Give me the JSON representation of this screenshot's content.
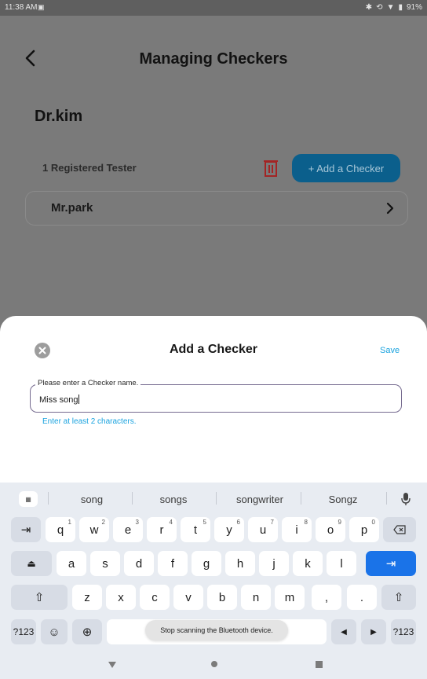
{
  "status_bar": {
    "time": "11:38 AM",
    "notif_icon": "ꟷ",
    "battery": "91%"
  },
  "app": {
    "title": "Managing Checkers",
    "owner_name": "Dr.kim",
    "registered_count": "1 Registered Tester",
    "add_checker_label": "+ Add a Checker",
    "checkers": [
      {
        "name": "Mr.park"
      }
    ]
  },
  "sheet": {
    "title": "Add a Checker",
    "save_label": "Save",
    "field_label": "Please enter a Checker name.",
    "field_value": "Miss song",
    "helper_text": "Enter at least 2 characters."
  },
  "keyboard": {
    "suggestions": [
      "song",
      "songs",
      "songwriter",
      "Songz"
    ],
    "row1": [
      {
        "label": "q",
        "sup": "1"
      },
      {
        "label": "w",
        "sup": "2"
      },
      {
        "label": "e",
        "sup": "3"
      },
      {
        "label": "r",
        "sup": "4"
      },
      {
        "label": "t",
        "sup": "5"
      },
      {
        "label": "y",
        "sup": "6"
      },
      {
        "label": "u",
        "sup": "7"
      },
      {
        "label": "i",
        "sup": "8"
      },
      {
        "label": "o",
        "sup": "9"
      },
      {
        "label": "p",
        "sup": "0"
      }
    ],
    "row2": [
      "a",
      "s",
      "d",
      "f",
      "g",
      "h",
      "j",
      "k",
      "l"
    ],
    "row3": [
      "z",
      "x",
      "c",
      "v",
      "b",
      "n",
      "m",
      ",",
      "."
    ],
    "symbols_label": "?123",
    "symbols_label_right": "?123"
  },
  "toast": {
    "text": "Stop scanning the Bluetooth device."
  },
  "colors": {
    "accent": "#1aa3df",
    "primary_button": "#0b5f8c",
    "delete": "#b03030",
    "keyboard_enter": "#1a73e8"
  }
}
